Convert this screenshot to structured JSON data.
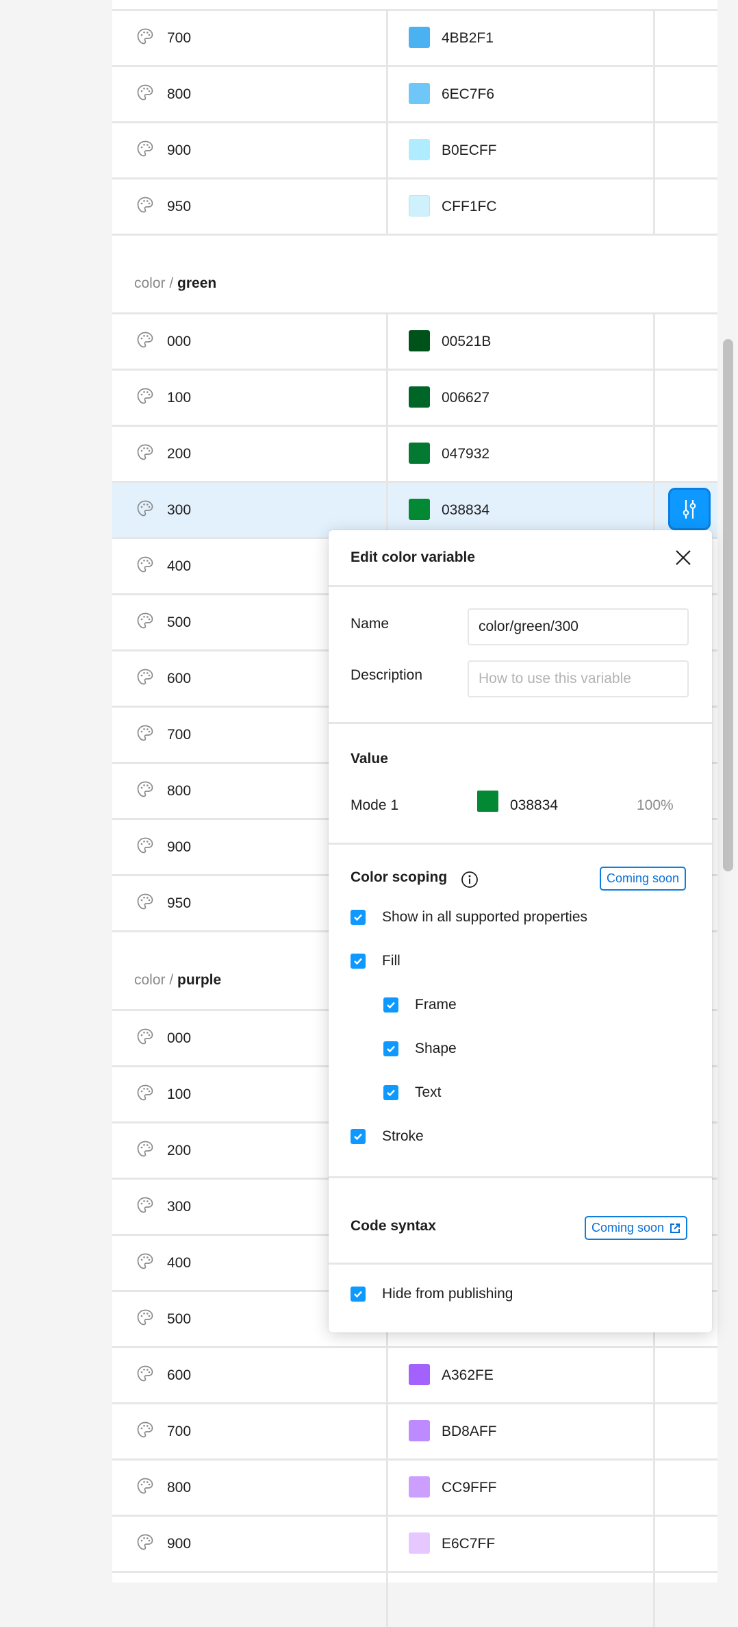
{
  "groups": [
    {
      "prefix": "",
      "name": "",
      "rows": [
        {
          "name": "700",
          "hex": "4BB2F1",
          "color": "#4BB2F1"
        },
        {
          "name": "800",
          "hex": "6EC7F6",
          "color": "#6EC7F6"
        },
        {
          "name": "900",
          "hex": "B0ECFF",
          "color": "#B0ECFF"
        },
        {
          "name": "950",
          "hex": "CFF1FC",
          "color": "#CFF1FC"
        }
      ]
    },
    {
      "prefix": "color / ",
      "name": "green",
      "rows": [
        {
          "name": "000",
          "hex": "00521B",
          "color": "#00521B"
        },
        {
          "name": "100",
          "hex": "006627",
          "color": "#006627"
        },
        {
          "name": "200",
          "hex": "047932",
          "color": "#047932"
        },
        {
          "name": "300",
          "hex": "038834",
          "color": "#038834",
          "selected": true
        },
        {
          "name": "400"
        },
        {
          "name": "500"
        },
        {
          "name": "600"
        },
        {
          "name": "700"
        },
        {
          "name": "800"
        },
        {
          "name": "900"
        },
        {
          "name": "950"
        }
      ]
    },
    {
      "prefix": "color / ",
      "name": "purple",
      "rows": [
        {
          "name": "000"
        },
        {
          "name": "100"
        },
        {
          "name": "200"
        },
        {
          "name": "300"
        },
        {
          "name": "400"
        },
        {
          "name": "500"
        },
        {
          "name": "600",
          "hex": "A362FE",
          "color": "#A362FE"
        },
        {
          "name": "700",
          "hex": "BD8AFF",
          "color": "#BD8AFF"
        },
        {
          "name": "800",
          "hex": "CC9FFF",
          "color": "#CC9FFF"
        },
        {
          "name": "900",
          "hex": "E6C7FF",
          "color": "#E6C7FF"
        },
        {
          "name": ""
        }
      ]
    }
  ],
  "panel": {
    "title": "Edit color variable",
    "name_label": "Name",
    "name_value": "color/green/300",
    "description_label": "Description",
    "description_placeholder": "How to use this variable",
    "value_heading": "Value",
    "mode_label": "Mode 1",
    "mode_hex": "038834",
    "mode_color": "#038834",
    "mode_opacity": "100%",
    "scoping_heading": "Color scoping",
    "scoping_badge": "Coming soon",
    "scoping_options": [
      {
        "label": "Show in all supported properties",
        "checked": true,
        "indent": 0
      },
      {
        "label": "Fill",
        "checked": true,
        "indent": 0
      },
      {
        "label": "Frame",
        "checked": true,
        "indent": 1
      },
      {
        "label": "Shape",
        "checked": true,
        "indent": 1
      },
      {
        "label": "Text",
        "checked": true,
        "indent": 1
      },
      {
        "label": "Stroke",
        "checked": true,
        "indent": 0
      }
    ],
    "code_syntax_heading": "Code syntax",
    "code_syntax_badge": "Coming soon",
    "hide_label": "Hide from publishing",
    "hide_checked": true
  },
  "colors": {
    "accent": "#0D99FF",
    "selected_row": "#E3F1FD",
    "link": "#0A6FD8"
  }
}
